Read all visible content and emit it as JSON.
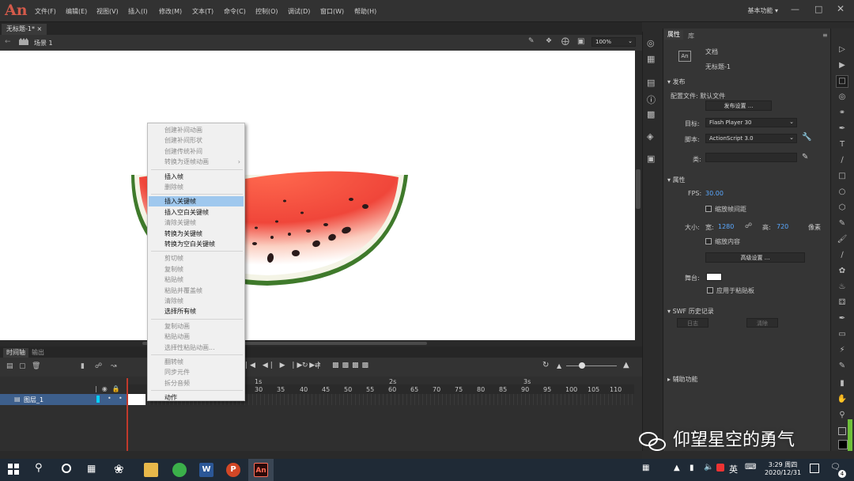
{
  "app": {
    "logo": "An",
    "workspace": "基本功能",
    "workspace_arrow": "▾"
  },
  "menu": [
    "文件(F)",
    "编辑(E)",
    "视图(V)",
    "插入(I)",
    "修改(M)",
    "文本(T)",
    "命令(C)",
    "控制(O)",
    "调试(D)",
    "窗口(W)",
    "帮助(H)"
  ],
  "document": {
    "tab_title": "无标题-1*",
    "scene": "场景 1",
    "zoom": "100%"
  },
  "context_menu": [
    {
      "label": "创建补间动画",
      "state": "disabled"
    },
    {
      "label": "创建补间形状",
      "state": "disabled"
    },
    {
      "label": "创建传统补间",
      "state": "disabled"
    },
    {
      "label": "转换为逐帧动画",
      "state": "disabled",
      "submenu": true
    },
    {
      "sep": true
    },
    {
      "label": "插入帧",
      "state": "enabled"
    },
    {
      "label": "删除帧",
      "state": "disabled"
    },
    {
      "sep": true
    },
    {
      "label": "插入关键帧",
      "state": "highlighted"
    },
    {
      "label": "插入空白关键帧",
      "state": "enabled"
    },
    {
      "label": "清除关键帧",
      "state": "disabled"
    },
    {
      "label": "转换为关键帧",
      "state": "enabled"
    },
    {
      "label": "转换为空白关键帧",
      "state": "enabled"
    },
    {
      "sep": true
    },
    {
      "label": "剪切帧",
      "state": "disabled"
    },
    {
      "label": "复制帧",
      "state": "disabled"
    },
    {
      "label": "粘贴帧",
      "state": "disabled"
    },
    {
      "label": "粘贴并覆盖帧",
      "state": "disabled"
    },
    {
      "label": "清除帧",
      "state": "disabled"
    },
    {
      "label": "选择所有帧",
      "state": "enabled"
    },
    {
      "sep": true
    },
    {
      "label": "复制动画",
      "state": "disabled"
    },
    {
      "label": "粘贴动画",
      "state": "disabled"
    },
    {
      "label": "选择性粘贴动画...",
      "state": "disabled"
    },
    {
      "sep": true
    },
    {
      "label": "翻转帧",
      "state": "disabled"
    },
    {
      "label": "同步元件",
      "state": "disabled"
    },
    {
      "label": "拆分音频",
      "state": "disabled"
    },
    {
      "sep": true
    },
    {
      "label": "动作",
      "state": "enabled"
    }
  ],
  "timeline": {
    "tabs": [
      "时间轴",
      "输出"
    ],
    "layer_name": "图层_1",
    "tick_labels": [
      "1s",
      "2s",
      "3s"
    ],
    "frame_numbers": [
      "30",
      "35",
      "40",
      "45",
      "50",
      "55",
      "60",
      "65",
      "70",
      "75",
      "80",
      "85",
      "90",
      "95",
      "100",
      "105",
      "110"
    ]
  },
  "properties_panel": {
    "tabs": [
      "属性",
      "库"
    ],
    "doc_type": "文档",
    "doc_name": "无标题-1",
    "publish_header": "发布",
    "profile_label": "配置文件: 默认文件",
    "publish_settings_btn": "发布设置 ...",
    "target_label": "目标:",
    "target_value": "Flash Player 30",
    "script_label": "脚本:",
    "script_value": "ActionScript 3.0",
    "class_label": "类:",
    "class_value": "",
    "props_header": "属性",
    "fps_label": "FPS:",
    "fps_value": "30.00",
    "scale_frames_label": "缩放帧间距",
    "size_label": "大小:",
    "width_label": "宽:",
    "width_value": "1280",
    "height_label": "高:",
    "height_value": "720",
    "unit": "像素",
    "scale_content_label": "缩放内容",
    "advanced_btn": "高级设置 ...",
    "stage_label": "舞台:",
    "stage_color": "#ffffff",
    "pasteboard_label": "应用于粘贴板",
    "swf_history_header": "SWF 历史记录",
    "log_btn": "日志",
    "clear_btn": "清除",
    "accessibility_header": "辅助功能"
  },
  "taskbar": {
    "time": "3:29 周四",
    "date": "2020/12/31",
    "lang": "英",
    "notif_count": "4"
  },
  "watermark": "仰望星空的勇气",
  "colors": {
    "accent_highlight": "#9fc8ee",
    "layer_selected": "#3d5f8c",
    "logo": "#d45a4a",
    "playhead": "#c0392b"
  }
}
